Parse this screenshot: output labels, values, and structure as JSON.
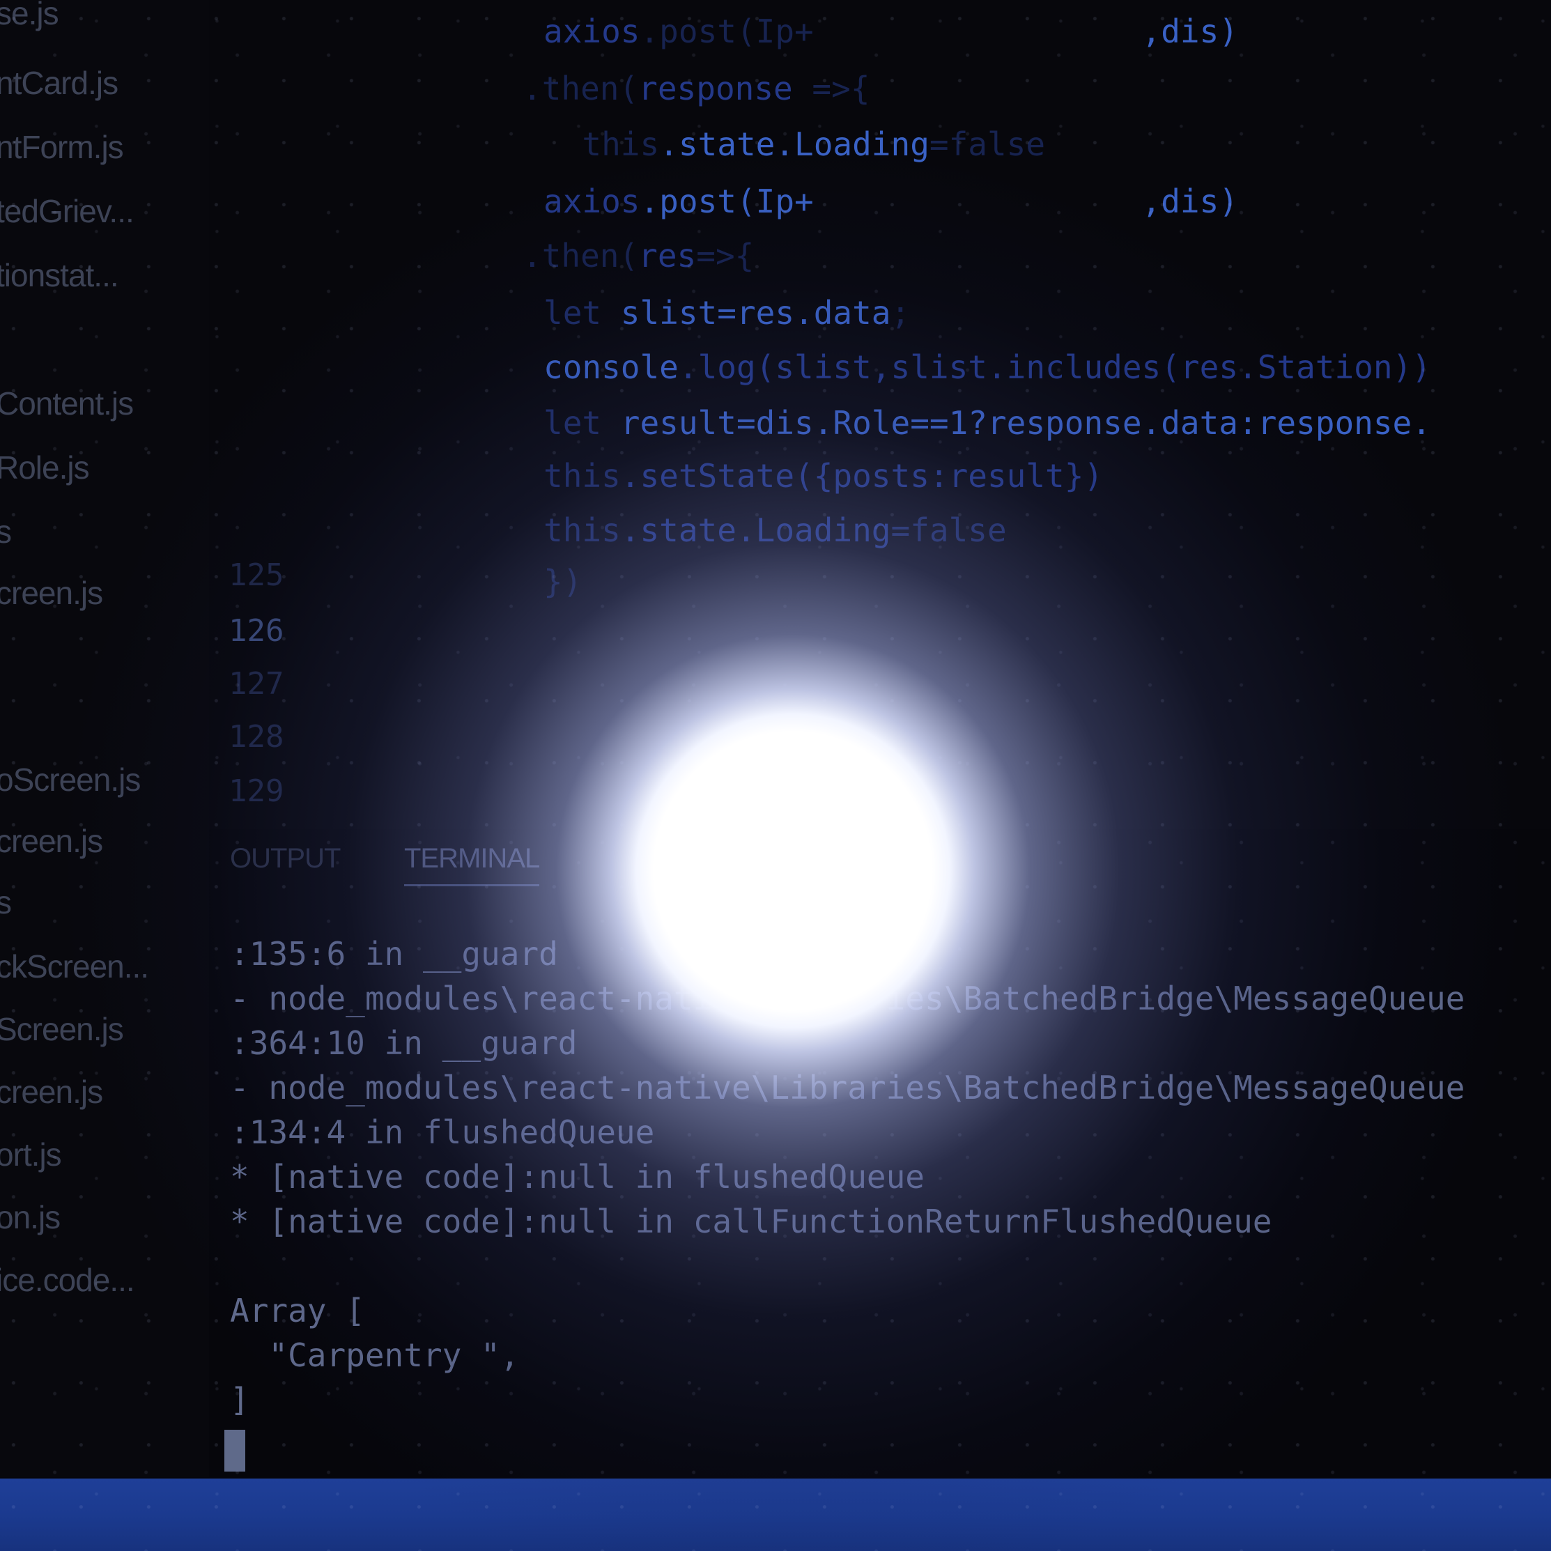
{
  "sidebar": {
    "files": [
      "se.js",
      "ntCard.js",
      "ntForm.js",
      "tedGriev...",
      "tionstat...",
      "Content.js",
      "Role.js",
      "s",
      "creen.js",
      "oScreen.js",
      "creen.js",
      "s",
      "ckScreen...",
      "Screen.js",
      "creen.js",
      "ort.js",
      "on.js",
      "ice.code..."
    ]
  },
  "editor": {
    "code_lines": [
      {
        "kw": "axios",
        "id": ".post(Ip+",
        "rest": "                 ,dis)"
      },
      {
        "kw": ".then(",
        "id": "response",
        "rest": " =>{"
      },
      {
        "kw": "  this",
        "id": ".state.Loading",
        "rest": "=false"
      },
      {
        "kw": "axios",
        "id": ".post(Ip+",
        "rest": "                 ,dis)"
      },
      {
        "kw": ".then(",
        "id": "res",
        "rest": "=>{"
      },
      {
        "kw": "let ",
        "id": "slist=res.data",
        "rest": ";"
      },
      {
        "kw": "console",
        "id": ".log(slist,slist",
        "rest": ".includes(res.Station))"
      },
      {
        "kw": "let ",
        "id": "result=dis.Role==1?response.data:response.",
        "rest": ""
      },
      {
        "kw": "this",
        "id": ".setState({posts:result})",
        "rest": ""
      },
      {
        "kw": "this",
        "id": ".state.Loading",
        "rest": "=false"
      },
      {
        "kw": "})",
        "id": "",
        "rest": ""
      }
    ],
    "line_numbers": [
      "125",
      "126",
      "127",
      "128",
      "129"
    ]
  },
  "panel": {
    "tabs": [
      "OUTPUT",
      "TERMINAL"
    ],
    "active_tab": "TERMINAL"
  },
  "terminal": {
    "lines": [
      ":135:6 in __guard",
      "- node_modules\\react-native\\Libraries\\BatchedBridge\\MessageQueue",
      ":364:10 in __guard",
      "- node_modules\\react-native\\Libraries\\BatchedBridge\\MessageQueue",
      ":134:4 in flushedQueue",
      "* [native code]:null in flushedQueue",
      "* [native code]:null in callFunctionReturnFlushedQueue",
      "",
      "Array [",
      "  \"Carpentry \",",
      "]"
    ]
  },
  "colors": {
    "background": "#06060b",
    "code_accent": "#3a62c6",
    "terminal_text": "#606a8c",
    "statusbar": "#1b3a8f"
  }
}
